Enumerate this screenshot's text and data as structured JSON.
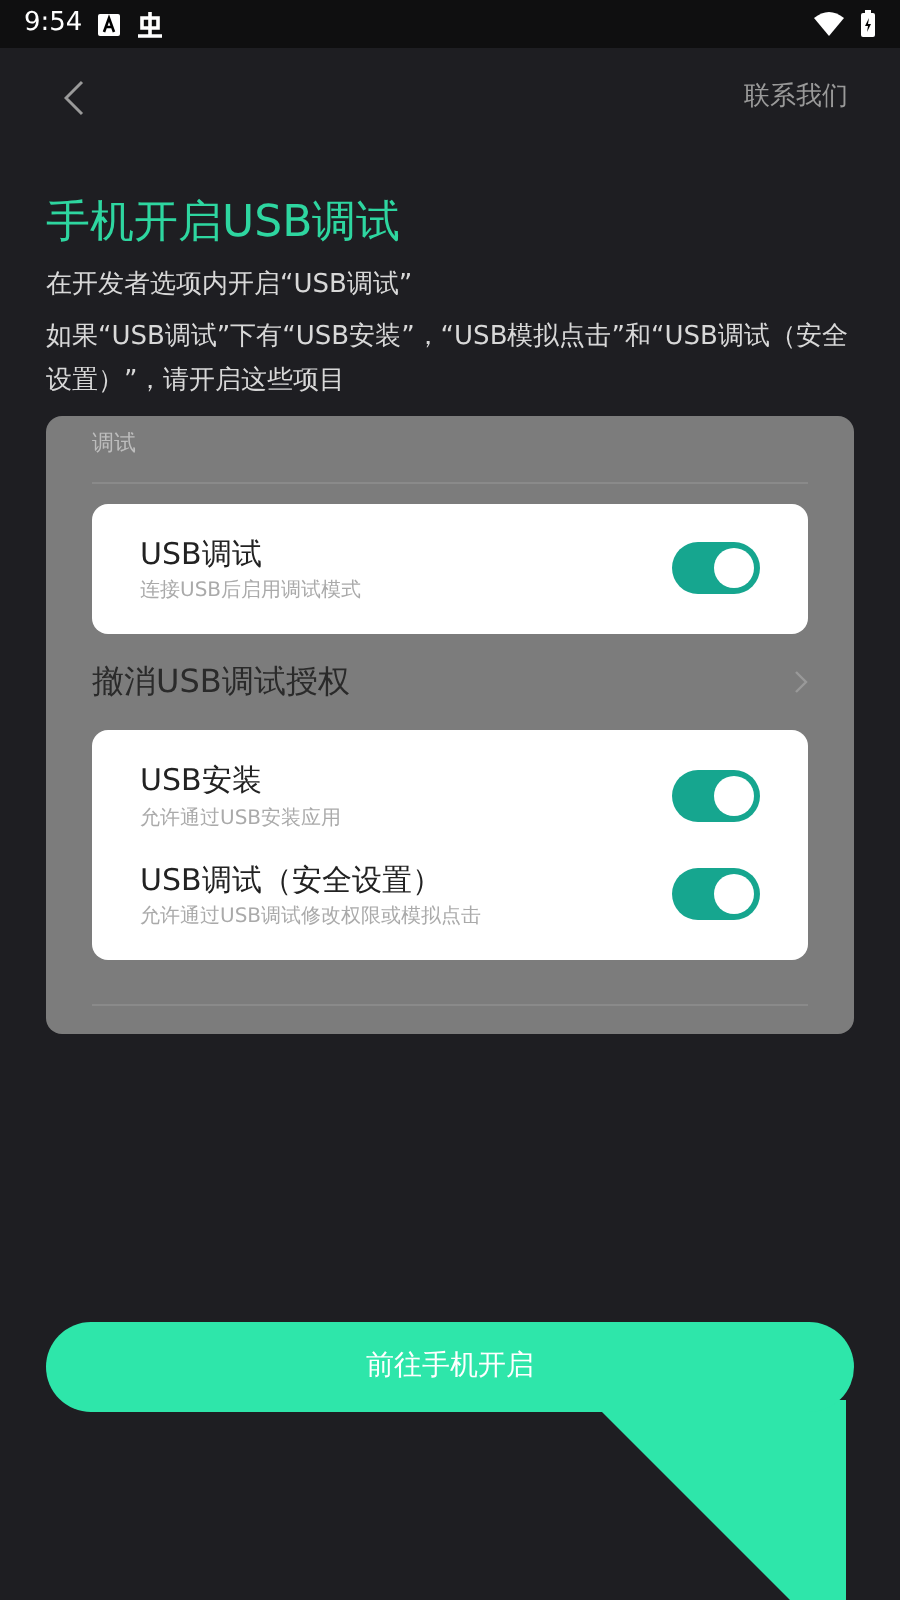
{
  "status_bar": {
    "time": "9:54"
  },
  "header": {
    "action": "联系我们"
  },
  "title": "手机开启USB调试",
  "instructions": [
    "在开发者选项内开启“USB调试”",
    "如果“USB调试”下有“USB安装”，“USB模拟点击”和“USB调试（安全设置）”，请开启这些项目"
  ],
  "settings_preview": {
    "section_label": "调试",
    "groups": [
      {
        "kind": "card",
        "items": [
          {
            "title": "USB调试",
            "subtitle": "连接USB后启用调试模式",
            "on": true
          }
        ]
      },
      {
        "kind": "link",
        "title": "撤消USB调试授权"
      },
      {
        "kind": "card",
        "items": [
          {
            "title": "USB安装",
            "subtitle": "允许通过USB安装应用",
            "on": true
          },
          {
            "title": "USB调试（安全设置）",
            "subtitle": "允许通过USB调试修改权限或模拟点击",
            "on": true
          }
        ]
      }
    ]
  },
  "primary_button": "前往手机开启"
}
